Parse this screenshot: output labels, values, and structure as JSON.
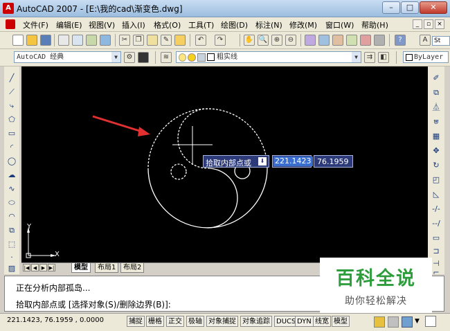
{
  "window": {
    "title": "AutoCAD 2007 - [E:\\我的cad\\渐变色.dwg]",
    "minimize": "–",
    "maximize": "□",
    "close": "✕"
  },
  "menu": [
    "文件(F)",
    "编辑(E)",
    "视图(V)",
    "插入(I)",
    "格式(O)",
    "工具(T)",
    "绘图(D)",
    "标注(N)",
    "修改(M)",
    "窗口(W)",
    "帮助(H)"
  ],
  "workspace": {
    "value": "AutoCAD 经典"
  },
  "layer": {
    "linetype": "粗实线",
    "lineweight": "ByLayer"
  },
  "toolbar_extra": {
    "style_label": "St"
  },
  "canvas": {
    "tooltip_prompt": "拾取内部点或",
    "tooltip_icon": "⬇",
    "dyn_x": "221.1423",
    "dyn_y": "76.1959",
    "ucs_y": "Y",
    "ucs_x": "X"
  },
  "tabs": [
    "模型",
    "布局1",
    "布局2"
  ],
  "command": {
    "line1": "正在分析内部孤岛...",
    "line2": "拾取内部点或 [选择对象(S)/删除边界(B)]:"
  },
  "status": {
    "coords": "221.1423, 76.1959 , 0.0000",
    "buttons": [
      "捕捉",
      "栅格",
      "正交",
      "极轴",
      "对象捕捉",
      "对象追踪",
      "DUCS",
      "DYN",
      "线宽",
      "模型"
    ]
  },
  "watermark": {
    "title": "百科全说",
    "subtitle": "助你轻松解决"
  },
  "colors": {
    "canvas": "#000000",
    "arrow": "#e03030",
    "dyn_box": "#2c3a7a",
    "dyn_selected": "#3a6fd0",
    "watermark_green": "#2e9e3c"
  }
}
